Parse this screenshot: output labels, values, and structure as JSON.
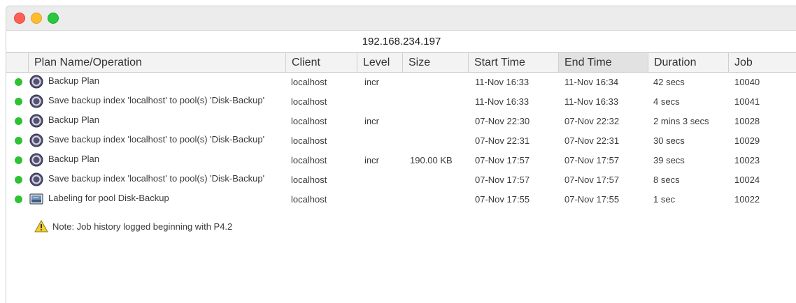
{
  "window": {
    "host": "192.168.234.197"
  },
  "columns": {
    "plan": "Plan Name/Operation",
    "client": "Client",
    "level": "Level",
    "size": "Size",
    "start": "Start Time",
    "end": "End Time",
    "duration": "Duration",
    "job": "Job"
  },
  "rows": [
    {
      "status": "success",
      "icon": "backup-plan-icon",
      "name": "Backup Plan",
      "client": "localhost",
      "level": "incr",
      "size": "",
      "start": "11-Nov 16:33",
      "end": "11-Nov 16:34",
      "duration": "42 secs",
      "job": "10040"
    },
    {
      "status": "success",
      "icon": "backup-plan-icon",
      "name": "Save backup index 'localhost' to pool(s) 'Disk-Backup'",
      "client": "localhost",
      "level": "",
      "size": "",
      "start": "11-Nov 16:33",
      "end": "11-Nov 16:33",
      "duration": "4 secs",
      "job": "10041"
    },
    {
      "status": "success",
      "icon": "backup-plan-icon",
      "name": "Backup Plan",
      "client": "localhost",
      "level": "incr",
      "size": "",
      "start": "07-Nov 22:30",
      "end": "07-Nov 22:32",
      "duration": "2 mins 3 secs",
      "job": "10028"
    },
    {
      "status": "success",
      "icon": "backup-plan-icon",
      "name": "Save backup index 'localhost' to pool(s) 'Disk-Backup'",
      "client": "localhost",
      "level": "",
      "size": "",
      "start": "07-Nov 22:31",
      "end": "07-Nov 22:31",
      "duration": "30 secs",
      "job": "10029"
    },
    {
      "status": "success",
      "icon": "backup-plan-icon",
      "name": "Backup Plan",
      "client": "localhost",
      "level": "incr",
      "size": "190.00 KB",
      "start": "07-Nov 17:57",
      "end": "07-Nov 17:57",
      "duration": "39 secs",
      "job": "10023"
    },
    {
      "status": "success",
      "icon": "backup-plan-icon",
      "name": "Save backup index 'localhost' to pool(s) 'Disk-Backup'",
      "client": "localhost",
      "level": "",
      "size": "",
      "start": "07-Nov 17:57",
      "end": "07-Nov 17:57",
      "duration": "8 secs",
      "job": "10024"
    },
    {
      "status": "success",
      "icon": "label-icon",
      "name": "Labeling for pool Disk-Backup",
      "client": "localhost",
      "level": "",
      "size": "",
      "start": "07-Nov 17:55",
      "end": "07-Nov 17:55",
      "duration": "1 sec",
      "job": "10022"
    }
  ],
  "note": {
    "icon": "warning-icon",
    "text": "Note: Job history logged beginning with P4.2"
  },
  "colors": {
    "status_success": "#2fc134",
    "sorted_header": "#e2e2e2"
  }
}
